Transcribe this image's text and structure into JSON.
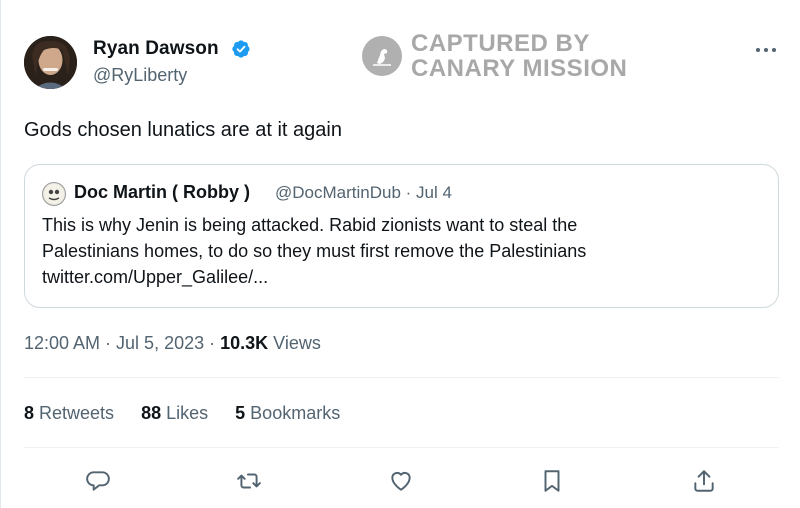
{
  "tweet": {
    "author_name": "Ryan Dawson",
    "author_handle": "@RyLiberty",
    "text": "Gods chosen lunatics are at it again",
    "timestamp": "12:00 AM · Jul 5, 2023 · ",
    "views_count": "10.3K",
    "views_label": " Views"
  },
  "watermark": {
    "line1": "CAPTURED BY",
    "line2": "CANARY MISSION"
  },
  "quote": {
    "author_name": "Doc Martin ( Robby )",
    "meta": "@DocMartinDub · Jul 4",
    "line1": "This is why Jenin is being attacked. Rabid zionists want to steal the",
    "line2": "Palestinians homes, to do so they must first remove the Palestinians",
    "line3": "twitter.com/Upper_Galilee/..."
  },
  "stats": {
    "retweets_count": "8",
    "retweets_label": " Retweets",
    "likes_count": "88",
    "likes_label": " Likes",
    "bookmarks_count": "5",
    "bookmarks_label": " Bookmarks"
  },
  "icons": {
    "verified": "verified-badge-icon",
    "more": "more-icon",
    "reply": "reply-icon",
    "retweet": "retweet-icon",
    "like": "heart-icon",
    "bookmark": "bookmark-icon",
    "share": "share-icon"
  },
  "colors": {
    "verified": "#1d9bf0",
    "secondary_text": "#536471",
    "watermark": "#a8a8a8"
  }
}
